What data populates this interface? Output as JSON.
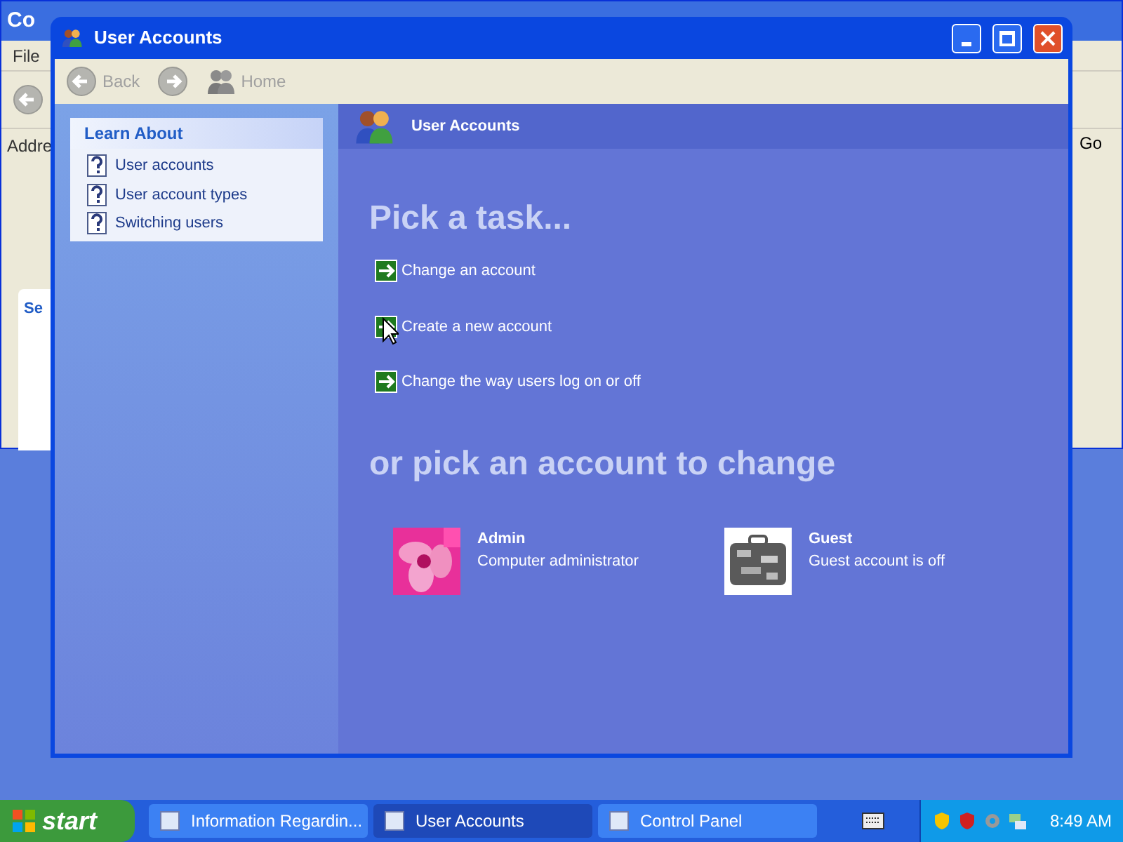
{
  "background_window": {
    "title": "Co",
    "menu": [
      "File"
    ],
    "address_label": "Addre",
    "go_button": "Go",
    "panel_heading": "Se"
  },
  "window": {
    "title": "User Accounts"
  },
  "toolbar": [
    {
      "kind": "back",
      "label": "Back",
      "disabled": true
    },
    {
      "kind": "forward",
      "disabled": true
    },
    {
      "kind": "home",
      "label": "Home",
      "disabled": true
    }
  ],
  "learn_about": {
    "title": "Learn About",
    "items": [
      "User accounts",
      "User account types",
      "Switching users"
    ]
  },
  "banner": {
    "title": "User Accounts"
  },
  "tasks_heading": "Pick a task...",
  "tasks": [
    "Change an account",
    "Create a new account",
    "Change the way users log on or off"
  ],
  "accounts_heading": "or pick an account to change",
  "accounts": [
    {
      "name": "Admin",
      "type": "Computer administrator",
      "kind": "flower"
    },
    {
      "name": "Guest",
      "type": "Guest account is off",
      "kind": "suitcase"
    }
  ],
  "taskbar": {
    "start": "start",
    "buttons": [
      {
        "label": "Information Regardin...",
        "selected": false
      },
      {
        "label": "User Accounts",
        "selected": true
      },
      {
        "label": "Control Panel",
        "selected": false
      }
    ],
    "clock": "8:49 AM"
  }
}
